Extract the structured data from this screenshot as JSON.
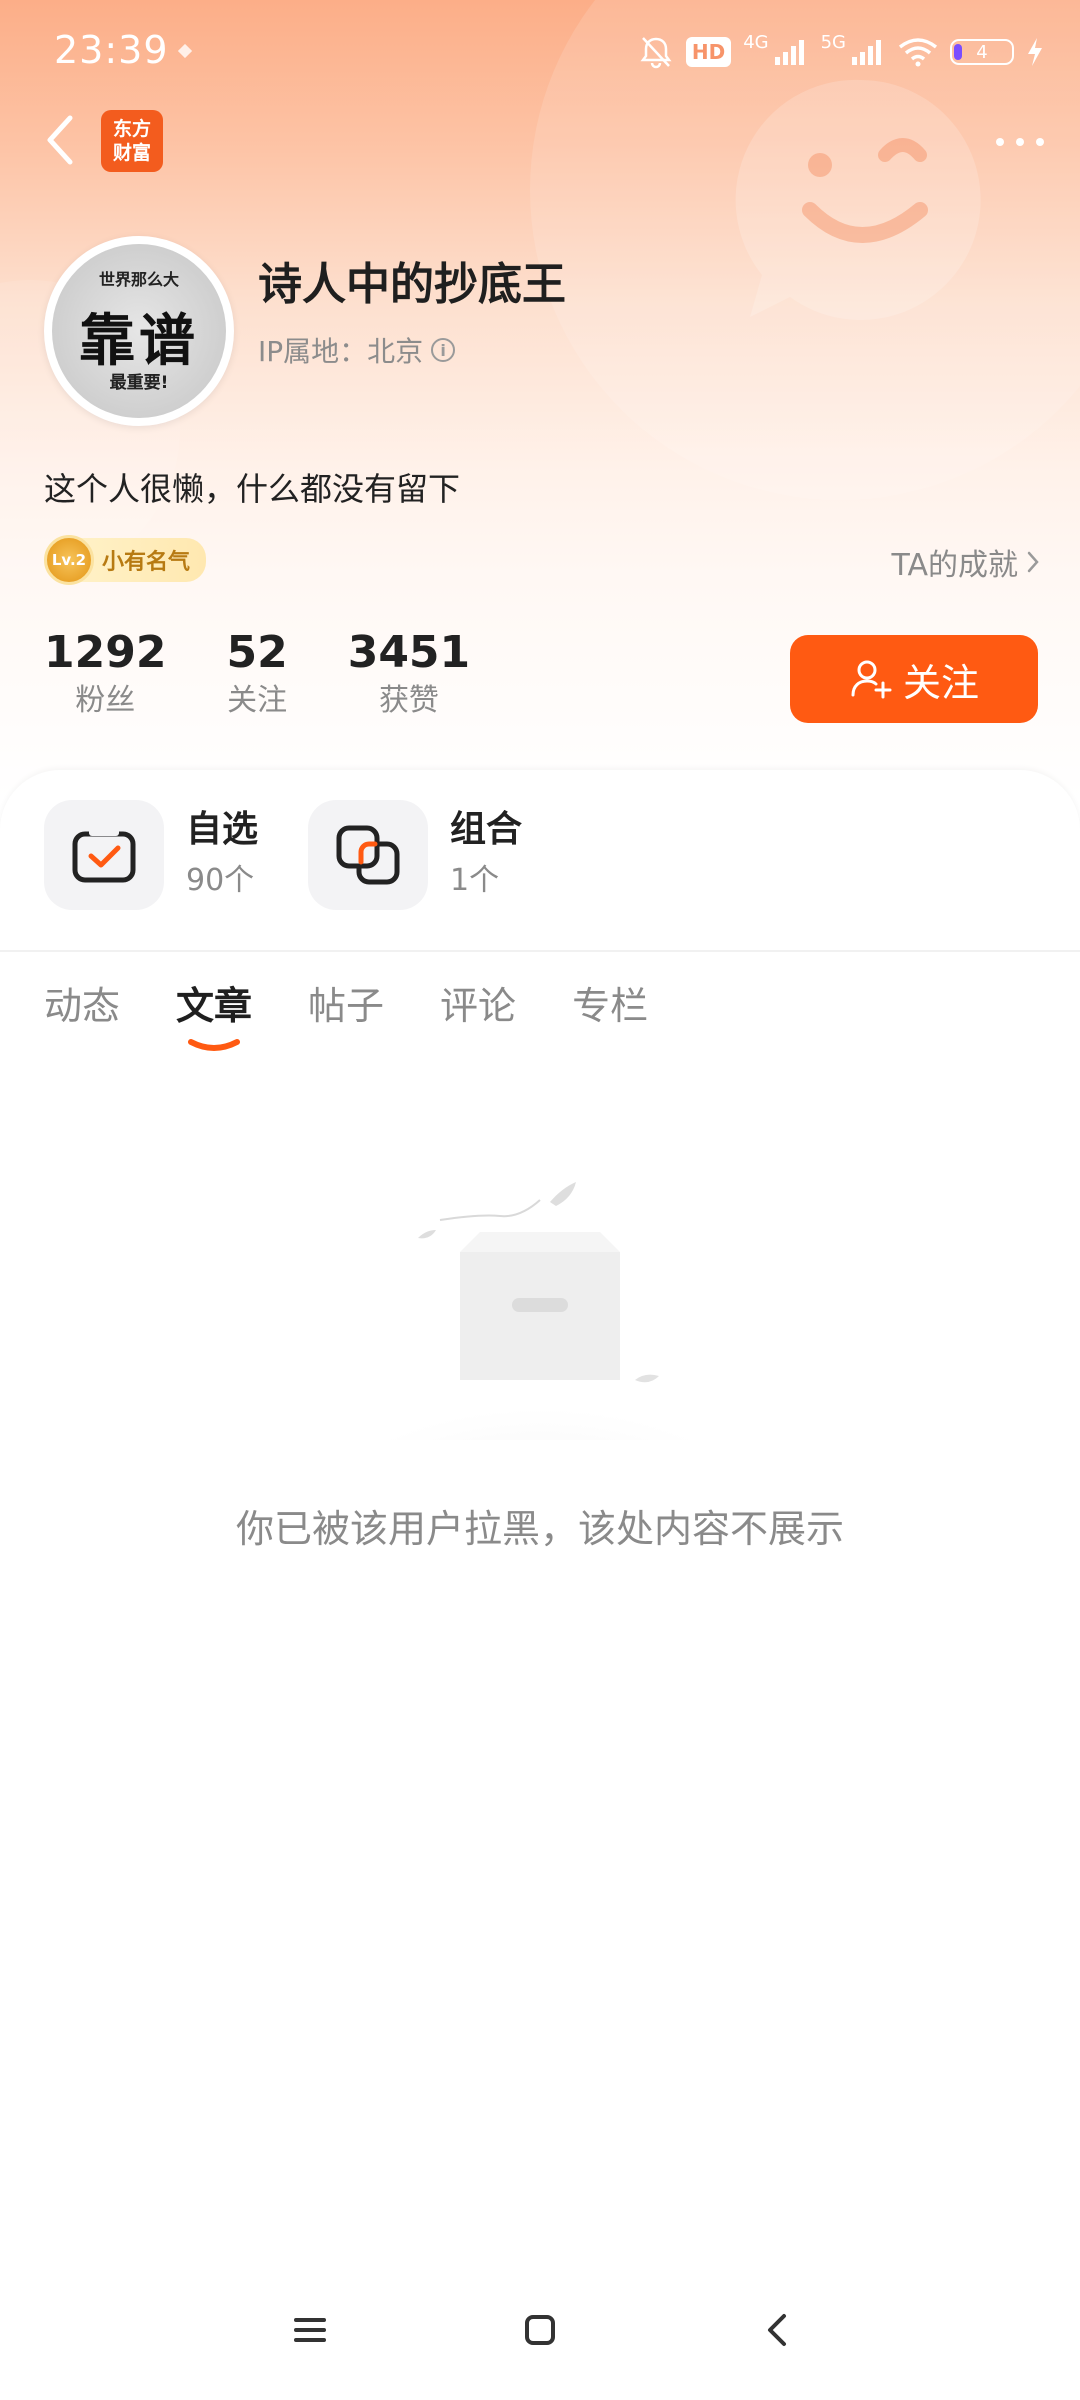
{
  "status_bar": {
    "time": "23:39",
    "hd": "HD",
    "net1": "4G",
    "net2": "5G",
    "battery": "4"
  },
  "app": {
    "logo_line1": "东方",
    "logo_line2": "财富"
  },
  "profile": {
    "avatar_top": "世界那么大",
    "avatar_mid": "靠谱",
    "avatar_bottom": "最重要!",
    "username": "诗人中的抄底王",
    "ip_location": "IP属地：北京",
    "bio": "这个人很懒，什么都没有留下",
    "level_badge": "Lv.2",
    "level_title": "小有名气",
    "achievements_link": "TA的成就"
  },
  "stats": [
    {
      "value": "1292",
      "label": "粉丝"
    },
    {
      "value": "52",
      "label": "关注"
    },
    {
      "value": "3451",
      "label": "获赞"
    }
  ],
  "follow_button": "关注",
  "quick_entries": {
    "watchlist": {
      "title": "自选",
      "count": "90个"
    },
    "portfolio": {
      "title": "组合",
      "count": "1个"
    }
  },
  "tabs": [
    {
      "label": "动态",
      "active": false
    },
    {
      "label": "文章",
      "active": true
    },
    {
      "label": "帖子",
      "active": false
    },
    {
      "label": "评论",
      "active": false
    },
    {
      "label": "专栏",
      "active": false
    }
  ],
  "empty_message": "你已被该用户拉黑，该处内容不展示",
  "colors": {
    "accent": "#ff5a12",
    "header_top": "#fcae88",
    "text_primary": "#222222",
    "text_secondary": "#8a8a8a"
  }
}
